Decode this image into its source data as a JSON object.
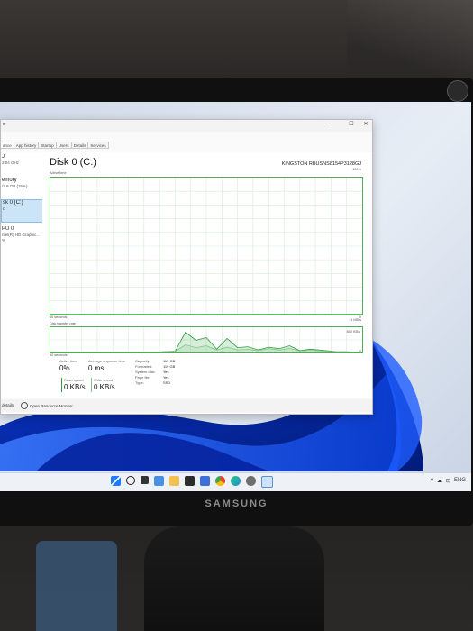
{
  "window": {
    "title": "er",
    "tabs": [
      "ance",
      "App history",
      "Startup",
      "Users",
      "Details",
      "Services"
    ],
    "active_tab": 0,
    "buttons": {
      "minimize": "–",
      "maximize": "☐",
      "close": "✕"
    }
  },
  "sidebar": {
    "items": [
      {
        "title": "J",
        "subtitle": "2.04 GHz",
        "selected": false
      },
      {
        "title": "emory",
        "subtitle": "/7.9 GB (25%)",
        "selected": false
      },
      {
        "title": "sk 0 (C:)",
        "subtitle": "D",
        "selected": true
      },
      {
        "title": "PU 0",
        "subtitle": "ntel(R) HD Graphic...",
        "subtitle2": "%",
        "selected": false
      }
    ]
  },
  "main": {
    "title": "Disk 0 (C:)",
    "model": "KINGSTON RBUSNS8154P3128GJ",
    "active_time_label": "Active time",
    "active_time_max": "100%",
    "active_time_duration": "60 seconds",
    "active_time_min": "0",
    "transfer_label": "Disk transfer rate",
    "transfer_max": "1 MB/s",
    "transfer_mid": "800 KB/s",
    "transfer_duration": "60 seconds",
    "transfer_min": "0"
  },
  "stats": {
    "active_time": {
      "label": "Active time",
      "value": "0%"
    },
    "response_time": {
      "label": "Average response time",
      "value": "0 ms"
    },
    "read_speed": {
      "label": "Read speed",
      "value": "0 KB/s"
    },
    "write_speed": {
      "label": "Write speed",
      "value": "0 KB/s"
    },
    "info": [
      {
        "key": "Capacity:",
        "value": "119 GB"
      },
      {
        "key": "Formatted:",
        "value": "119 GB"
      },
      {
        "key": "System disk:",
        "value": "Yes"
      },
      {
        "key": "Page file:",
        "value": "Yes"
      },
      {
        "key": "Type:",
        "value": "SSD"
      }
    ]
  },
  "footer": {
    "fewer_details": "details",
    "open_resource_monitor": "Open Resource Monitor"
  },
  "monitor": {
    "brand": "SAMSUNG"
  },
  "taskbar": {
    "icons": [
      "start-icon",
      "search-icon",
      "task-view-icon",
      "widgets-icon",
      "file-explorer-icon",
      "store-icon",
      "mail-icon",
      "chrome-icon",
      "edge-icon",
      "settings-icon",
      "task-manager-icon"
    ],
    "tray": [
      "^",
      "☁",
      "⊡",
      "ENG"
    ]
  },
  "chart_data": [
    {
      "type": "line",
      "title": "Active time",
      "ylim": [
        0,
        100
      ],
      "x": [
        0,
        5,
        10,
        15,
        20,
        25,
        30,
        35,
        40,
        45,
        50,
        55,
        60
      ],
      "series": [
        {
          "values": [
            0,
            0,
            0,
            0,
            0,
            0,
            0,
            0,
            0,
            0,
            0,
            0,
            0
          ]
        }
      ]
    },
    {
      "type": "area",
      "title": "Disk transfer rate",
      "ylim": [
        0,
        1000
      ],
      "x": [
        0,
        5,
        10,
        15,
        20,
        24,
        26,
        28,
        30,
        32,
        34,
        36,
        38,
        40,
        42,
        44,
        46,
        48,
        50,
        55,
        60
      ],
      "series": [
        {
          "values": [
            0,
            0,
            0,
            0,
            0,
            30,
            820,
            480,
            600,
            120,
            560,
            180,
            220,
            90,
            200,
            140,
            260,
            60,
            120,
            20,
            0
          ]
        },
        {
          "values": [
            0,
            0,
            0,
            0,
            0,
            20,
            300,
            180,
            260,
            80,
            200,
            90,
            110,
            60,
            140,
            80,
            150,
            40,
            70,
            10,
            0
          ]
        }
      ]
    }
  ]
}
